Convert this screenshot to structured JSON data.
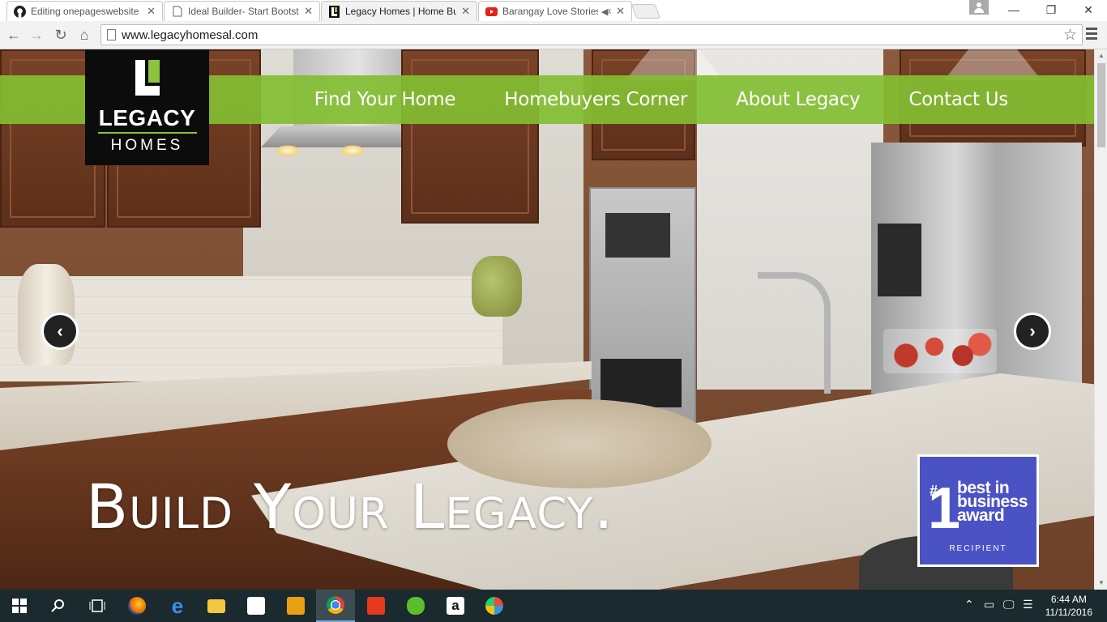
{
  "browser": {
    "tabs": [
      {
        "title": "Editing onepageswebsite",
        "icon": "github-icon",
        "active": false
      },
      {
        "title": "Ideal Builder- Start Bootst",
        "icon": "page-icon",
        "active": false
      },
      {
        "title": "Legacy Homes | Home Bu",
        "icon": "legacy-favicon",
        "active": true
      },
      {
        "title": "Barangay Love Stories",
        "icon": "youtube-icon",
        "active": false,
        "muted": true
      }
    ],
    "close_glyph": "✕",
    "url": "www.legacyhomesal.com"
  },
  "site": {
    "logo": {
      "word": "LEGACY",
      "sub": "HOMES"
    },
    "nav": [
      "Find Your Home",
      "Homebuyers Corner",
      "About Legacy",
      "Contact Us"
    ],
    "hero": "Build Your Legacy.",
    "award": {
      "num": "1",
      "hash": "#",
      "lines": [
        "best in",
        "business",
        "award"
      ],
      "recipient": "RECIPIENT"
    },
    "prev_glyph": "‹",
    "next_glyph": "›",
    "colors": {
      "accent": "#83be32",
      "award_blue": "#4b53c4",
      "logo_bg": "#0c0c0c"
    }
  },
  "taskbar": {
    "apps": [
      "start-icon",
      "search-icon",
      "task-view-icon",
      "firefox-icon",
      "edge-icon",
      "file-explorer-icon",
      "store-icon",
      "app-icon",
      "chrome-icon",
      "shopping-icon",
      "cloud-icon",
      "amazon-icon",
      "paint-icon"
    ],
    "time": "6:44 AM",
    "date": "11/11/2016"
  }
}
